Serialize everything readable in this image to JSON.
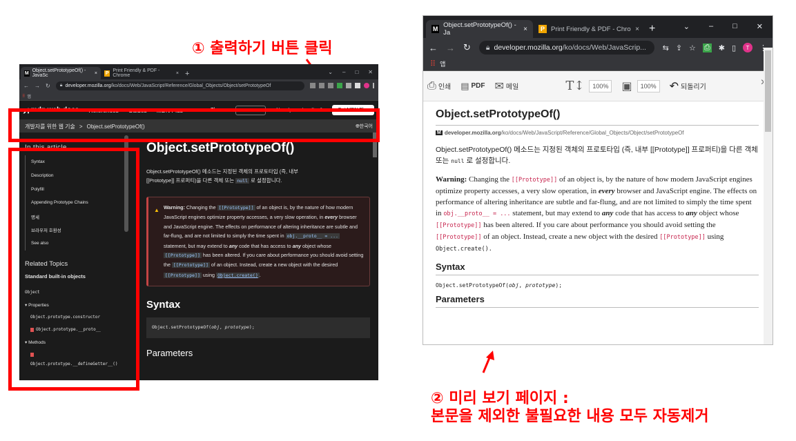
{
  "annotations": {
    "step1": "① 출력하기 버튼 클릭",
    "step2_line1": "② 미리 보기 페이지 :",
    "step2_line2": "본문을 제외한 불필요한 내용 모두 자동제거",
    "color": "#ff0000"
  },
  "left_browser": {
    "tabs": [
      {
        "favicon": "M",
        "title": "Object.setPrototypeOf() - JavaSc",
        "close": "×"
      },
      {
        "favicon": "P",
        "title": "Print Friendly & PDF - Chrome",
        "close": "×"
      }
    ],
    "new_tab": "+",
    "url_domain": "developer.mozilla.org",
    "url_path": "/ko/docs/Web/JavaScript/Reference/Global_Objects/Object/setPrototypeOf",
    "bookmarks_label": "앱",
    "mdn": {
      "logo": "mdn web docs",
      "nav": [
        "References",
        "Guides",
        "MDN Plus"
      ],
      "theme": "Theme",
      "subscriber": "Already a subscriber?",
      "get_plus": "Get MDN Plus",
      "breadcrumb_1": "개발자를 위한 웹 기술",
      "breadcrumb_sep": ">",
      "breadcrumb_2": "Object.setPrototypeOf()",
      "lang": "한국어",
      "in_this_article": "In this article",
      "toc": [
        "Syntax",
        "Description",
        "Polyfill",
        "Appending Prototype Chains",
        "명세",
        "브라우저 호환성",
        "See also"
      ],
      "related_topics": "Related Topics",
      "standard_objects": "Standard built-in objects",
      "object": "Object",
      "properties": "▾ Properties",
      "prop_items": [
        "Object.prototype.constructor",
        "Object.prototype.__proto__"
      ],
      "methods": "▾ Methods",
      "method_item": "Object.prototype.__defineGetter__()",
      "title": "Object.setPrototypeOf()",
      "intro_a": "Object.setPrototypeOf() 메소드는 지정된 객체의 프로토타입 (즉, 내부",
      "intro_b": "[[Prototype]] 프로퍼티)을 다른 객체 또는",
      "intro_null": "null",
      "intro_c": "로 설정합니다.",
      "warn_label": "Warning:",
      "warn_1": "Changing the",
      "code_proto": "[[Prototype]]",
      "warn_2": "of an object is, by the nature of how modern JavaScript engines optimize property accesses, a very slow operation, in",
      "every": "every",
      "warn_3": "browser and JavaScript engine. The effects on performance of altering inheritance are subtle and far-flung, and are not limited to simply the time spent in",
      "code_obj_proto": "obj.__proto__ = ...",
      "warn_4": "statement, but may extend to",
      "any": "any",
      "warn_5": "code that has access to",
      "warn_6": "object whose",
      "warn_7": "has been altered. If you care about performance you should avoid setting the",
      "warn_8": "of an object. Instead, create a new object with the desired",
      "warn_9": "using",
      "code_create": "Object.create()",
      "syntax": "Syntax",
      "sig_a": "Object.setPrototypeOf(",
      "sig_obj": "obj",
      "sig_sep": ", ",
      "sig_proto": "prototype",
      "sig_b": ");",
      "parameters": "Parameters"
    }
  },
  "right_browser": {
    "tabs": [
      {
        "favicon": "M",
        "title": "Object.setPrototypeOf() - Ja",
        "close": "×"
      },
      {
        "favicon": "P",
        "title": "Print Friendly & PDF - Chro",
        "close": "×"
      }
    ],
    "new_tab": "+",
    "url_domain": "developer.mozilla.org",
    "url_path": "/ko/docs/Web/JavaScrip...",
    "bookmarks_label": "앱",
    "toolbar": {
      "print": "인쇄",
      "pdf": "PDF",
      "email": "메일",
      "text_pct": "100%",
      "img_pct": "100%",
      "undo": "되돌리기",
      "close": "×"
    },
    "page": {
      "title": "Object.setPrototypeOf()",
      "src_domain": "developer.mozilla.org",
      "src_path": "/ko/docs/Web/JavaScript/Reference/Global_Objects/Object/setPrototypeOf",
      "intro_a": "Object.setPrototypeOf() 메소드는 지정된 객체의 프로토타입 (즉, 내부 [[Prototype]] 프로퍼티)을 다른 객체 또는",
      "intro_null": "null",
      "intro_b": "로 설정합니다.",
      "warn_label": "Warning:",
      "warn_1": "Changing the",
      "code_proto": "[[Prototype]]",
      "warn_2": "of an object is, by the nature of how modern JavaScript engines optimize property accesses, a very slow operation, in",
      "every": "every",
      "warn_3": "browser and JavaScript engine. The effects on performance of altering inheritance are subtle and far-flung, and are not limited to simply the time spent in",
      "code_obj_proto": "obj.__proto__ = ...",
      "warn_4": "statement, but may extend to",
      "any": "any",
      "warn_5": "code that has access to",
      "warn_6": "object whose",
      "warn_7": "has been altered. If you care about performance you should avoid setting the",
      "warn_8": "of an object. Instead, create a new object with the desired",
      "warn_9": "using",
      "code_create": "Object.create().",
      "syntax": "Syntax",
      "sig_a": "Object.setPrototypeOf(",
      "sig_obj": "obj",
      "sig_sep": ", ",
      "sig_proto": "prototype",
      "sig_b": ");",
      "parameters": "Parameters"
    }
  }
}
